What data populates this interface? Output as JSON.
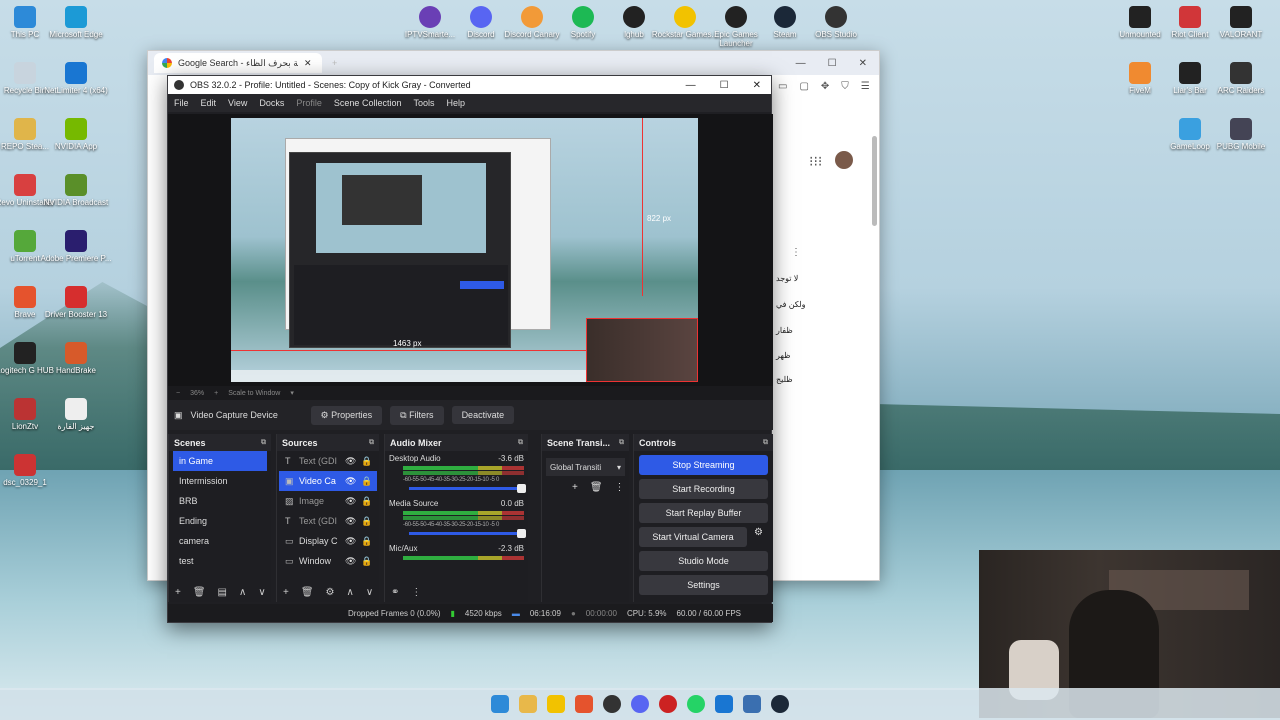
{
  "desktop_icons_left": [
    {
      "label": "This PC",
      "color": "#2d8ad8"
    },
    {
      "label": "Microsoft Edge",
      "color": "#1c9ad6"
    },
    {
      "label": "Recycle Bin",
      "color": "#c8d4de"
    },
    {
      "label": "NetLimiter 4 (x64)",
      "color": "#1976d2"
    },
    {
      "label": "REPO Stea...",
      "color": "#e0b54a"
    },
    {
      "label": "NVIDIA App",
      "color": "#76b900"
    },
    {
      "label": "Revo Uninstaller",
      "color": "#d84040"
    },
    {
      "label": "NVIDIA Broadcast",
      "color": "#5a8f29"
    },
    {
      "label": "uTorrent",
      "color": "#55a83a"
    },
    {
      "label": "Adobe Premiere P...",
      "color": "#2a1e6e"
    },
    {
      "label": "Brave",
      "color": "#e5532d"
    },
    {
      "label": "Driver Booster 13",
      "color": "#d62e2e"
    },
    {
      "label": "Logitech G HUB",
      "color": "#222"
    },
    {
      "label": "HandBrake",
      "color": "#d75a2a"
    },
    {
      "label": "LionZtv",
      "color": "#b33"
    },
    {
      "label": "جهيز الفارة",
      "color": "#eee"
    },
    {
      "label": "dsc_0329_1",
      "color": "#c33"
    }
  ],
  "desktop_icons_top": [
    "IPTVSmarte...",
    "Discord",
    "Discord Canary",
    "Spotify",
    "lghub",
    "Rockstar Games...",
    "Epic Games Launcher",
    "Steam",
    "OBS Studio"
  ],
  "desktop_icons_right": [
    {
      "label": "Unmounted",
      "color": "#222"
    },
    {
      "label": "Riot Client",
      "color": "#d13639"
    },
    {
      "label": "VALORANT",
      "color": "#222"
    },
    {
      "label": "FiveM",
      "color": "#f08a30"
    },
    {
      "label": "Liar's Bar",
      "color": "#222"
    },
    {
      "label": "ARC Raiders",
      "color": "#333"
    },
    {
      "label": "GameLoop",
      "color": "#3aa0e0"
    },
    {
      "label": "PUBG Mobile",
      "color": "#445"
    }
  ],
  "chrome": {
    "tab_title": "Google Search - دولة بحرف الظاء",
    "side_texts": [
      "لا توجد",
      "ولكن في",
      "ظفار",
      "ظهر",
      "ظليج"
    ]
  },
  "obs": {
    "title": "OBS 32.0.2 - Profile: Untitled - Scenes: Copy of Kick Gray - Converted",
    "menu": [
      "File",
      "Edit",
      "View",
      "Docks",
      "Profile",
      "Scene Collection",
      "Tools",
      "Help"
    ],
    "preview_labels": {
      "height_px": "822 px",
      "width_px": "1463 px"
    },
    "zoom": {
      "percent": "36%",
      "mode": "Scale to Window"
    },
    "source_toolbar": {
      "source_name": "Video Capture Device",
      "properties": "Properties",
      "filters": "Filters",
      "deactivate": "Deactivate"
    },
    "docks": {
      "scenes": {
        "title": "Scenes",
        "items": [
          "in Game",
          "Intermission",
          "BRB",
          "Ending",
          "camera",
          "test"
        ],
        "selected": 0
      },
      "sources": {
        "title": "Sources",
        "items": [
          "Text (GDI",
          "Video Ca",
          "Image",
          "Text (GDI",
          "Display C",
          "Window"
        ],
        "selected": 1
      },
      "mixer": {
        "title": "Audio Mixer",
        "channels": [
          {
            "name": "Desktop Audio",
            "db": "-3.6 dB"
          },
          {
            "name": "Media Source",
            "db": "0.0 dB"
          },
          {
            "name": "Mic/Aux",
            "db": "-2.3 dB"
          }
        ],
        "scale": "-60-55-50-45-40-35-30-25-20-15-10 -5 0"
      },
      "transitions": {
        "title": "Scene Transi...",
        "value": "Global Transiti"
      },
      "controls": {
        "title": "Controls",
        "buttons": [
          "Stop Streaming",
          "Start Recording",
          "Start Replay Buffer",
          "Start Virtual Camera",
          "Studio Mode",
          "Settings"
        ]
      }
    },
    "status": {
      "dropped": "Dropped Frames 0 (0.0%)",
      "kbps": "4520 kbps",
      "stream_time": "06:16:09",
      "rec_time": "00:00:00",
      "cpu": "CPU: 5.9%",
      "fps": "60.00 / 60.00 FPS"
    }
  }
}
